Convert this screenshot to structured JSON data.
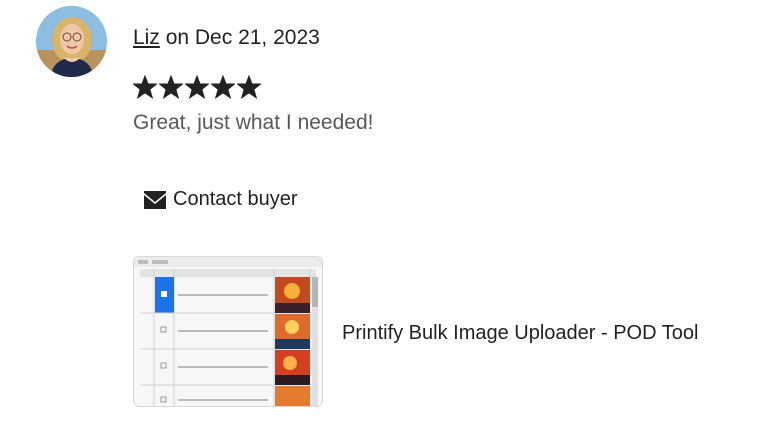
{
  "review": {
    "reviewer_name": "Liz",
    "date_text": " on Dec 21, 2023",
    "rating": 5,
    "rating_max": 5,
    "text": "Great, just what I needed!"
  },
  "actions": {
    "contact_label": "Contact buyer",
    "contact_icon": "envelope-icon"
  },
  "product": {
    "title": "Printify Bulk Image Uploader - POD Tool"
  },
  "colors": {
    "star": "#222222",
    "secondary_text": "#595959",
    "selected_row": "#1a73e8"
  }
}
